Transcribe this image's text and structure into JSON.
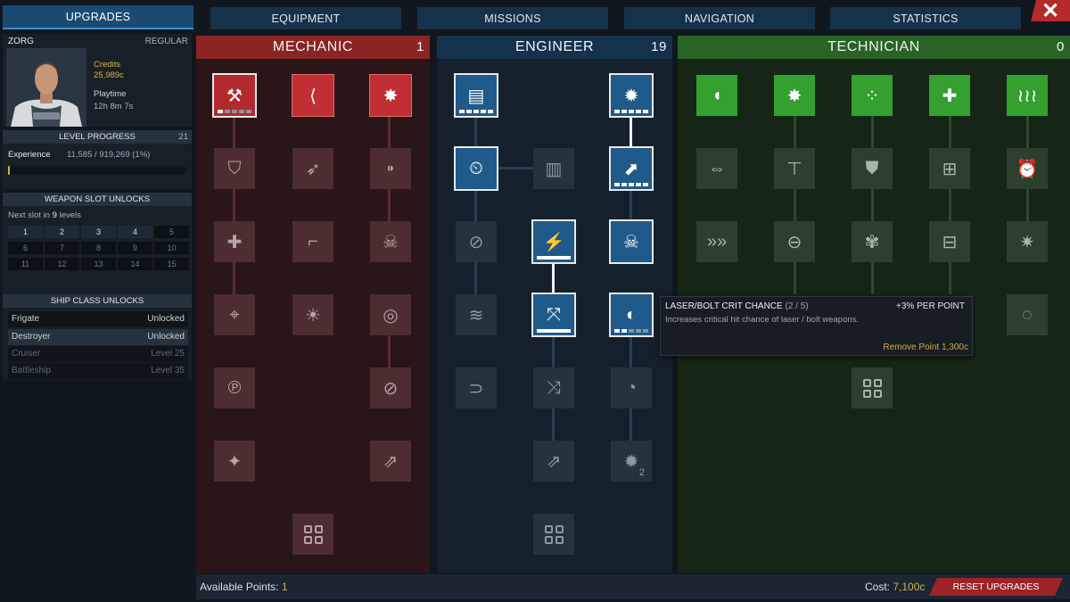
{
  "tabs": [
    {
      "label": "UPGRADES",
      "active": true
    },
    {
      "label": "EQUIPMENT",
      "active": false
    },
    {
      "label": "MISSIONS",
      "active": false
    },
    {
      "label": "NAVIGATION",
      "active": false
    },
    {
      "label": "STATISTICS",
      "active": false
    }
  ],
  "close_icon": "close-icon",
  "pilot": {
    "name": "ZORG",
    "rank": "REGULAR",
    "credits_label": "Credits",
    "credits_value": "25,989c",
    "playtime_label": "Playtime",
    "playtime_value": "12h 8m 7s"
  },
  "level_progress": {
    "title": "LEVEL PROGRESS",
    "level": "21",
    "experience_label": "Experience",
    "experience_value": "11,585 / 919,269 (1%)",
    "progress_fraction": 0.01
  },
  "weapon_slots": {
    "title": "WEAPON SLOT UNLOCKS",
    "next_prefix": "Next slot in ",
    "next_levels": "9",
    "next_suffix": " levels",
    "slots": [
      {
        "n": "1",
        "unlocked": true
      },
      {
        "n": "2",
        "unlocked": true
      },
      {
        "n": "3",
        "unlocked": true
      },
      {
        "n": "4",
        "unlocked": true
      },
      {
        "n": "5",
        "unlocked": false
      },
      {
        "n": "6",
        "unlocked": false
      },
      {
        "n": "7",
        "unlocked": false
      },
      {
        "n": "8",
        "unlocked": false
      },
      {
        "n": "9",
        "unlocked": false
      },
      {
        "n": "10",
        "unlocked": false
      },
      {
        "n": "11",
        "unlocked": false
      },
      {
        "n": "12",
        "unlocked": false
      },
      {
        "n": "13",
        "unlocked": false
      },
      {
        "n": "14",
        "unlocked": false
      },
      {
        "n": "15",
        "unlocked": false
      }
    ]
  },
  "ship_classes": {
    "title": "SHIP CLASS UNLOCKS",
    "rows": [
      {
        "name": "Frigate",
        "status": "Unlocked"
      },
      {
        "name": "Destroyer",
        "status": "Unlocked"
      },
      {
        "name": "Cruiser",
        "status": "Level 25"
      },
      {
        "name": "Battleship",
        "status": "Level 35"
      }
    ]
  },
  "columns": {
    "mechanic": {
      "title": "MECHANIC",
      "points": "1"
    },
    "engineer": {
      "title": "ENGINEER",
      "points": "19"
    },
    "technician": {
      "title": "TECHNICIAN",
      "points": "0"
    }
  },
  "engineer_ranks": {
    "node_1": {
      "ranks": 5,
      "filled": 5
    },
    "node_2": {
      "ranks": 5,
      "filled": 5
    },
    "node_3": {
      "ranks": 5,
      "filled": 5
    },
    "node_4": {
      "ranks": 5,
      "filled": 5
    },
    "node_5": {
      "ranks": 1,
      "filled": 1
    },
    "node_6": {
      "ranks": 1,
      "filled": 1
    },
    "node_7": {
      "ranks": 5,
      "filled": 2
    }
  },
  "mechanic_ranks": {
    "node_1": {
      "ranks": 5,
      "filled": 1
    }
  },
  "engineer_node_badge": "2",
  "tooltip": {
    "title": "LASER/BOLT CRIT CHANCE",
    "rank": "(2 / 5)",
    "bonus": "+3% PER POINT",
    "description": "Increases critical hit chance of laser / bolt weapons.",
    "remove": "Remove Point 1,300c"
  },
  "footer": {
    "available_label": "Available Points:",
    "available_value": "1",
    "cost_label": "Cost:",
    "cost_value": "7,100c",
    "reset_label": "RESET UPGRADES"
  }
}
